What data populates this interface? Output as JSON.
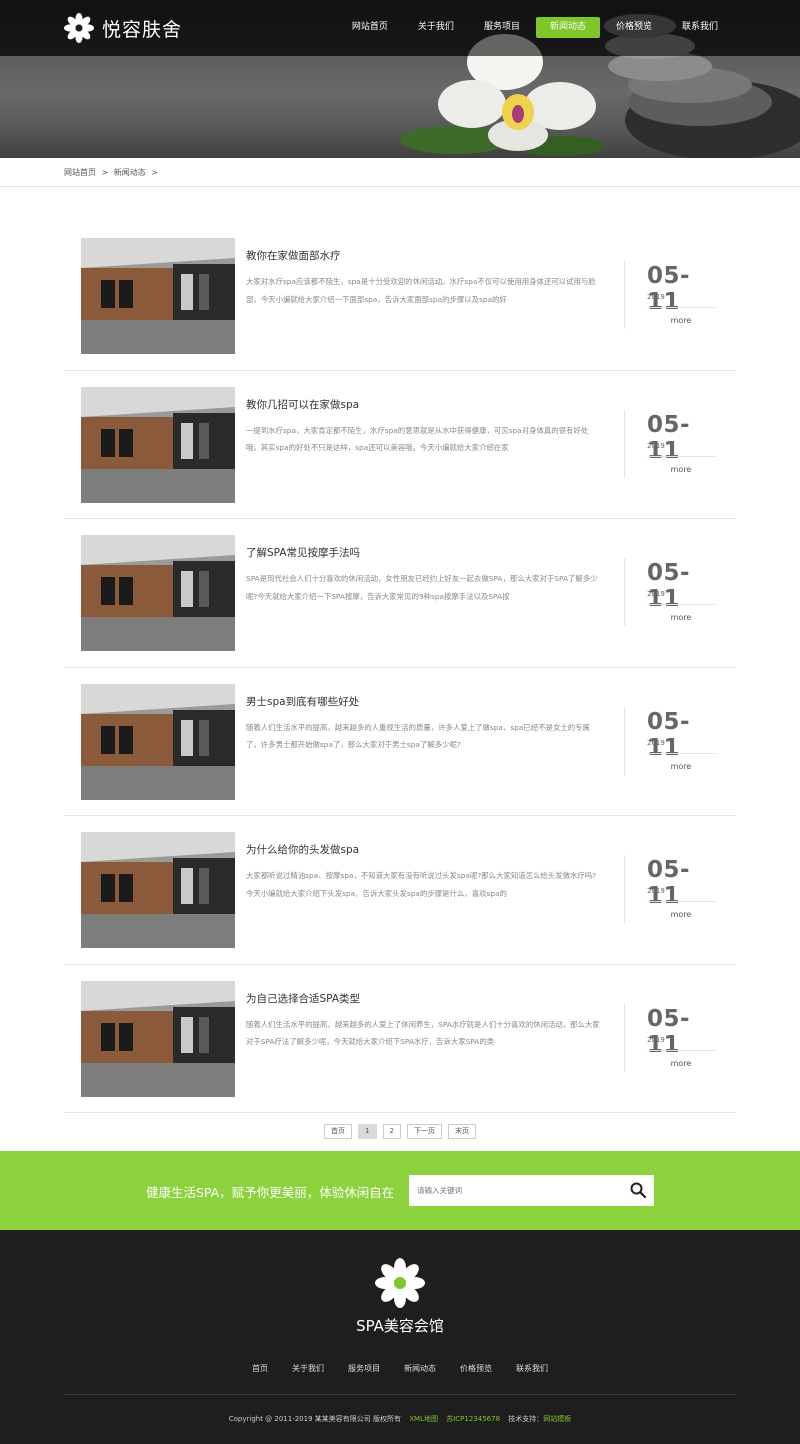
{
  "header": {
    "brand": "悦容肤舍",
    "nav": [
      {
        "label": "网站首页",
        "active": false
      },
      {
        "label": "关于我们",
        "active": false
      },
      {
        "label": "服务项目",
        "active": false
      },
      {
        "label": "新闻动态",
        "active": true
      },
      {
        "label": "价格预览",
        "active": false
      },
      {
        "label": "联系我们",
        "active": false
      }
    ]
  },
  "breadcrumb": {
    "home": "网站首页",
    "current": "新闻动态",
    "separator": ">"
  },
  "news": [
    {
      "title": "教你在家做面部水疗",
      "summary": "大家对水疗spa应该都不陌生，spa是十分受欢迎的休闲活动。水疗spa不仅可以使用用身体还可以试用与脸部，今天小编就给大家介绍一下面部spa，告诉大家面部spa的步骤以及spa的好",
      "date": "05-11",
      "year": "2019",
      "more": "more"
    },
    {
      "title": "教你几招可以在家做spa",
      "summary": "一提到水疗spa，大家肯定都不陌生，水疗spa的意思就是从水中获得健康，可见spa对身体真的很有好处哦，其实spa的好处不只是这样，spa还可以美容哦。今天小编就给大家介绍在家",
      "date": "05-11",
      "year": "2019",
      "more": "more"
    },
    {
      "title": "了解SPA常见按摩手法吗",
      "summary": "SPA是现代社会人们十分喜欢的休闲活动，女性朋友已经约上好友一起去做SPA，那么大家对于SPA了解多少呢?今天就给大家介绍一下SPA按摩，告诉大家常见的9种spa按摩手法以及SPA按",
      "date": "05-11",
      "year": "2019",
      "more": "more"
    },
    {
      "title": "男士spa到底有哪些好处",
      "summary": "随着人们生活水平的提高，越来越多的人重视生活的质量，许多人爱上了做spa，spa已经不是女士的专属了，许多男士都开始做spa了，那么大家对于男士spa了解多少呢?",
      "date": "05-11",
      "year": "2019",
      "more": "more"
    },
    {
      "title": "为什么给你的头发做spa",
      "summary": "大家都听说过精油spa、按摩spa，不知道大家有没有听说过头发spa呢?那么大家知道怎么给头发做水疗吗?今天小编就给大家介绍下头发spa，告诉大家头发spa的步骤是什么，喜欢spa的",
      "date": "05-11",
      "year": "2019",
      "more": "more"
    },
    {
      "title": "为自己选择合适SPA类型",
      "summary": "随着人们生活水平的提高，越来越多的人爱上了休闲养生，SPA水疗就是人们十分喜欢的休闲活动，那么大家对于SPA疗法了解多少呢，今天就给大家介绍下SPA水疗，告诉大家SPA的类",
      "date": "05-11",
      "year": "2019",
      "more": "more"
    }
  ],
  "pagination": {
    "first": "首页",
    "pages": [
      "1",
      "2"
    ],
    "current": "1",
    "next": "下一页",
    "last": "末页"
  },
  "band": {
    "slogan": "健康生活SPA，赋予你更美丽，体验休闲自在",
    "search_placeholder": "请输入关键词"
  },
  "footer": {
    "brand": "SPA美容会馆",
    "nav": [
      "首页",
      "关于我们",
      "服务项目",
      "新闻动态",
      "价格预览",
      "联系我们"
    ],
    "copyright": "Copyright @ 2011-2019 某某美容有限公司 版权所有",
    "xml": "XML地图",
    "icp": "苏ICP12345678",
    "support_label": "技术支持：",
    "support_link": "网站模板"
  },
  "colors": {
    "accent": "#7fc62a",
    "band": "#8bd23c",
    "footer_bg": "#1e1e1f"
  }
}
